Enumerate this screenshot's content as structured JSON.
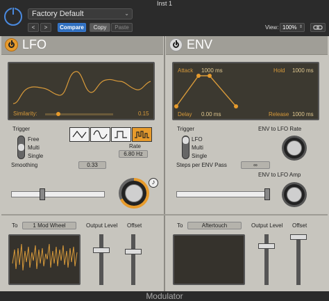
{
  "window": {
    "title": "Inst 1"
  },
  "header": {
    "preset": "Factory Default",
    "prev_label": "<",
    "next_label": ">",
    "compare_label": "Compare",
    "copy_label": "Copy",
    "paste_label": "Paste",
    "view_label": "View:",
    "zoom": "100%"
  },
  "lfo": {
    "title": "LFO",
    "similarity_label": "Similarity:",
    "similarity_value": "0.15",
    "trigger_label": "Trigger",
    "trigger_options": [
      "Free",
      "Multi",
      "Single"
    ],
    "smoothing_label": "Smoothing",
    "smoothing_value": "0.33",
    "rate_label": "Rate",
    "rate_value": "6.80 Hz",
    "target_prefix": "To",
    "target": "1 Mod Wheel",
    "output_level_label": "Output Level",
    "offset_label": "Offset"
  },
  "env": {
    "title": "ENV",
    "attack_label": "Attack",
    "attack_value": "1000 ms",
    "hold_label": "Hold",
    "hold_value": "1000 ms",
    "delay_label": "Delay",
    "delay_value": "0.00 ms",
    "release_label": "Release",
    "release_value": "1000 ms",
    "trigger_label": "Trigger",
    "trigger_options": [
      "LFO",
      "Multi",
      "Single"
    ],
    "env_to_lfo_rate_label": "ENV to LFO Rate",
    "env_to_lfo_amp_label": "ENV to LFO Amp",
    "steps_label": "Steps per ENV Pass",
    "steps_value": "∞",
    "target_prefix": "To",
    "target": "Aftertouch",
    "output_level_label": "Output Level",
    "offset_label": "Offset"
  },
  "footer": {
    "title": "Modulator"
  },
  "colors": {
    "accent": "#e79b2c",
    "compare_blue": "#2f6fbf",
    "panel": "#c7c5be"
  }
}
